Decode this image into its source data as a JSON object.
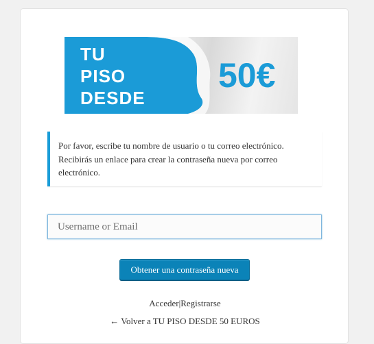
{
  "logo": {
    "line1": "TU",
    "line2": "PISO",
    "line3": "DESDE",
    "price": "50€",
    "colors": {
      "blue": "#1b9bd7",
      "white": "#ffffff"
    }
  },
  "message": {
    "line1": "Por favor, escribe tu nombre de usuario o tu correo electrónico.",
    "line2": "Recibirás un enlace para crear la contraseña nueva por correo",
    "line3": "electrónico."
  },
  "form": {
    "username_placeholder": "Username or Email",
    "username_value": "",
    "submit_label": "Obtener una contraseña nueva"
  },
  "nav": {
    "login_label": "Acceder",
    "separator": "|",
    "register_label": "Registrarse"
  },
  "back": {
    "arrow": "←",
    "label": "Volver a TU PISO DESDE 50 EUROS"
  },
  "colors": {
    "accent": "#1a9dd8",
    "button": "#0b83b8",
    "background": "#f1f1f1"
  }
}
